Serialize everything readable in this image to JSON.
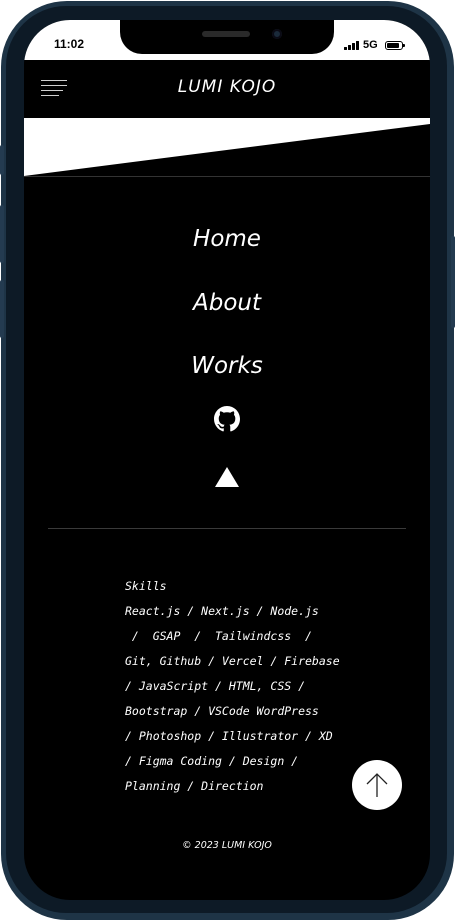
{
  "status": {
    "time": "11:02",
    "network": "5G"
  },
  "header": {
    "logo": "LUMI KOJO"
  },
  "nav": [
    {
      "label": "Home"
    },
    {
      "label": "About"
    },
    {
      "label": "Works"
    }
  ],
  "icons": {
    "github": "github-icon",
    "triangle": "triangle-icon",
    "arrow_up": "arrow-up-icon",
    "menu": "hamburger-menu-icon"
  },
  "skills": {
    "lines": [
      "Skills",
      "React.js  /  Next.js  /  Node.js",
      " /  GSAP  /  Tailwindcss  /",
      "Git, Github / Vercel / Firebase",
      "/ JavaScript / HTML, CSS /",
      "Bootstrap / VSCode WordPress",
      "/ Photoshop / Illustrator / XD",
      "/ Figma Coding / Design /",
      "Planning / Direction"
    ]
  },
  "footer": {
    "copyright": "© 2023 LUMI KOJO"
  },
  "colors": {
    "background": "#000000",
    "text": "#ffffff",
    "frame": "#1e3446"
  }
}
